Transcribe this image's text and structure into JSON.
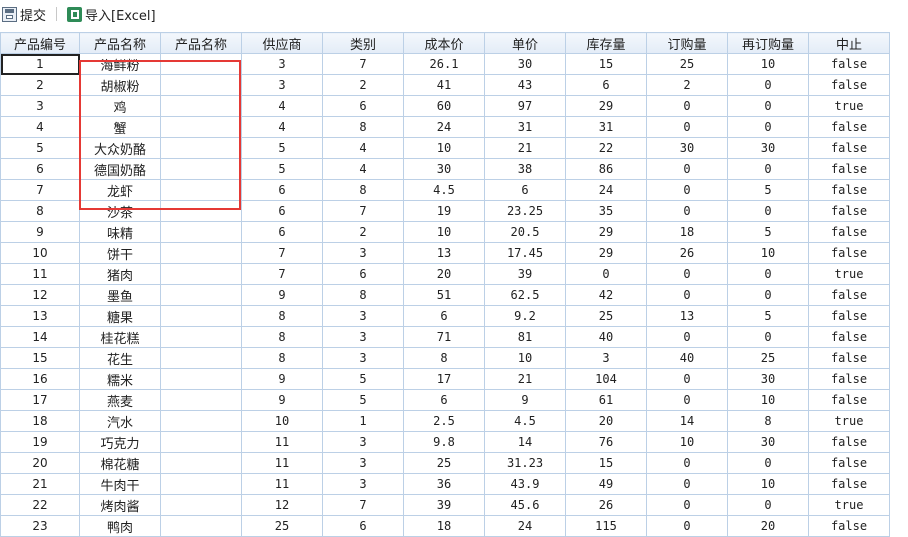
{
  "toolbar": {
    "submit_label": "提交",
    "import_label": "导入[Excel]"
  },
  "table": {
    "headers": [
      "产品编号",
      "产品名称",
      "产品名称",
      "供应商",
      "类别",
      "成本价",
      "单价",
      "库存量",
      "订购量",
      "再订购量",
      "中止"
    ],
    "rows": [
      [
        "1",
        "海鲜粉",
        "",
        "3",
        "7",
        "26.1",
        "30",
        "15",
        "25",
        "10",
        "false"
      ],
      [
        "2",
        "胡椒粉",
        "",
        "3",
        "2",
        "41",
        "43",
        "6",
        "2",
        "0",
        "false"
      ],
      [
        "3",
        "鸡",
        "",
        "4",
        "6",
        "60",
        "97",
        "29",
        "0",
        "0",
        "true"
      ],
      [
        "4",
        "蟹",
        "",
        "4",
        "8",
        "24",
        "31",
        "31",
        "0",
        "0",
        "false"
      ],
      [
        "5",
        "大众奶酪",
        "",
        "5",
        "4",
        "10",
        "21",
        "22",
        "30",
        "30",
        "false"
      ],
      [
        "6",
        "德国奶酪",
        "",
        "5",
        "4",
        "30",
        "38",
        "86",
        "0",
        "0",
        "false"
      ],
      [
        "7",
        "龙虾",
        "",
        "6",
        "8",
        "4.5",
        "6",
        "24",
        "0",
        "5",
        "false"
      ],
      [
        "8",
        "沙茶",
        "",
        "6",
        "7",
        "19",
        "23.25",
        "35",
        "0",
        "0",
        "false"
      ],
      [
        "9",
        "味精",
        "",
        "6",
        "2",
        "10",
        "20.5",
        "29",
        "18",
        "5",
        "false"
      ],
      [
        "10",
        "饼干",
        "",
        "7",
        "3",
        "13",
        "17.45",
        "29",
        "26",
        "10",
        "false"
      ],
      [
        "11",
        "猪肉",
        "",
        "7",
        "6",
        "20",
        "39",
        "0",
        "0",
        "0",
        "true"
      ],
      [
        "12",
        "墨鱼",
        "",
        "9",
        "8",
        "51",
        "62.5",
        "42",
        "0",
        "0",
        "false"
      ],
      [
        "13",
        "糖果",
        "",
        "8",
        "3",
        "6",
        "9.2",
        "25",
        "13",
        "5",
        "false"
      ],
      [
        "14",
        "桂花糕",
        "",
        "8",
        "3",
        "71",
        "81",
        "40",
        "0",
        "0",
        "false"
      ],
      [
        "15",
        "花生",
        "",
        "8",
        "3",
        "8",
        "10",
        "3",
        "40",
        "25",
        "false"
      ],
      [
        "16",
        "糯米",
        "",
        "9",
        "5",
        "17",
        "21",
        "104",
        "0",
        "30",
        "false"
      ],
      [
        "17",
        "燕麦",
        "",
        "9",
        "5",
        "6",
        "9",
        "61",
        "0",
        "10",
        "false"
      ],
      [
        "18",
        "汽水",
        "",
        "10",
        "1",
        "2.5",
        "4.5",
        "20",
        "14",
        "8",
        "true"
      ],
      [
        "19",
        "巧克力",
        "",
        "11",
        "3",
        "9.8",
        "14",
        "76",
        "10",
        "30",
        "false"
      ],
      [
        "20",
        "棉花糖",
        "",
        "11",
        "3",
        "25",
        "31.23",
        "15",
        "0",
        "0",
        "false"
      ],
      [
        "21",
        "牛肉干",
        "",
        "11",
        "3",
        "36",
        "43.9",
        "49",
        "0",
        "10",
        "false"
      ],
      [
        "22",
        "烤肉酱",
        "",
        "12",
        "7",
        "39",
        "45.6",
        "26",
        "0",
        "0",
        "true"
      ],
      [
        "23",
        "鸭肉",
        "",
        "25",
        "6",
        "18",
        "24",
        "115",
        "0",
        "20",
        "false"
      ]
    ]
  }
}
